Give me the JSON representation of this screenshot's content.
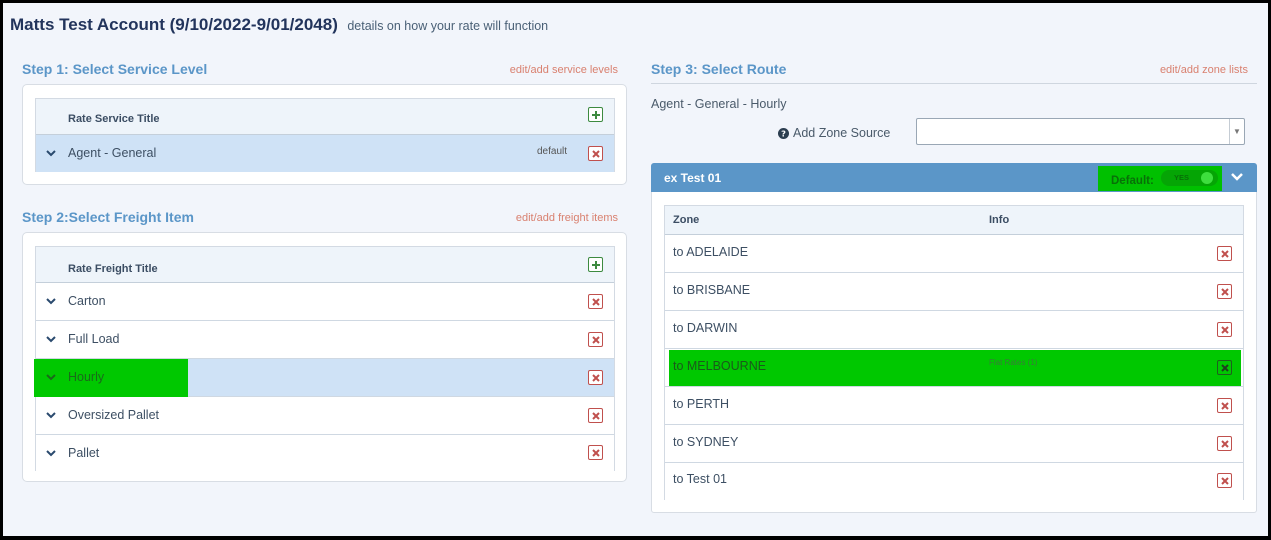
{
  "header": {
    "title": "Matts Test Account (9/10/2022-9/01/2048)",
    "subtitle": "details on how your rate will function"
  },
  "step1": {
    "title": "Step 1: Select Service Level",
    "edit_link": "edit/add service levels",
    "column_header": "Rate Service Title",
    "rows": [
      {
        "label": "Agent - General",
        "tag": "default",
        "selected": true
      }
    ]
  },
  "step2": {
    "title": "Step 2:Select Freight Item",
    "edit_link": "edit/add freight items",
    "column_header": "Rate Freight Title",
    "rows": [
      {
        "label": "Carton"
      },
      {
        "label": "Full Load"
      },
      {
        "label": "Hourly",
        "selected": true,
        "highlighted": true
      },
      {
        "label": "Oversized Pallet"
      },
      {
        "label": "Pallet"
      }
    ]
  },
  "step3": {
    "title": "Step 3: Select Route",
    "edit_link": "edit/add zone lists",
    "route_name": "Agent - General - Hourly",
    "add_zone_source_label": "Add Zone Source",
    "zone_source_value": "",
    "group": {
      "title": "ex Test 01",
      "default_label": "Default:",
      "default_toggle": "YES"
    },
    "columns": [
      "Zone",
      "Info"
    ],
    "zones": [
      {
        "zone": "to ADELAIDE",
        "info": ""
      },
      {
        "zone": "to BRISBANE",
        "info": ""
      },
      {
        "zone": "to DARWIN",
        "info": ""
      },
      {
        "zone": "to MELBOURNE",
        "info": "Flat Rates (1)",
        "highlighted": true
      },
      {
        "zone": "to PERTH",
        "info": ""
      },
      {
        "zone": "to SYDNEY",
        "info": ""
      },
      {
        "zone": "to Test 01",
        "info": ""
      }
    ]
  },
  "icons": {
    "expand": "chevron-down-icon",
    "remove": "close-box-icon",
    "add": "plus-box-icon",
    "help": "question-circle-icon"
  },
  "colors": {
    "section_title": "#5b96c8",
    "edit_link": "#d9806f",
    "selected_row": "#cfe2f6",
    "highlight": "#00c800",
    "remove": "#c0504d",
    "add": "#3d8a40"
  }
}
